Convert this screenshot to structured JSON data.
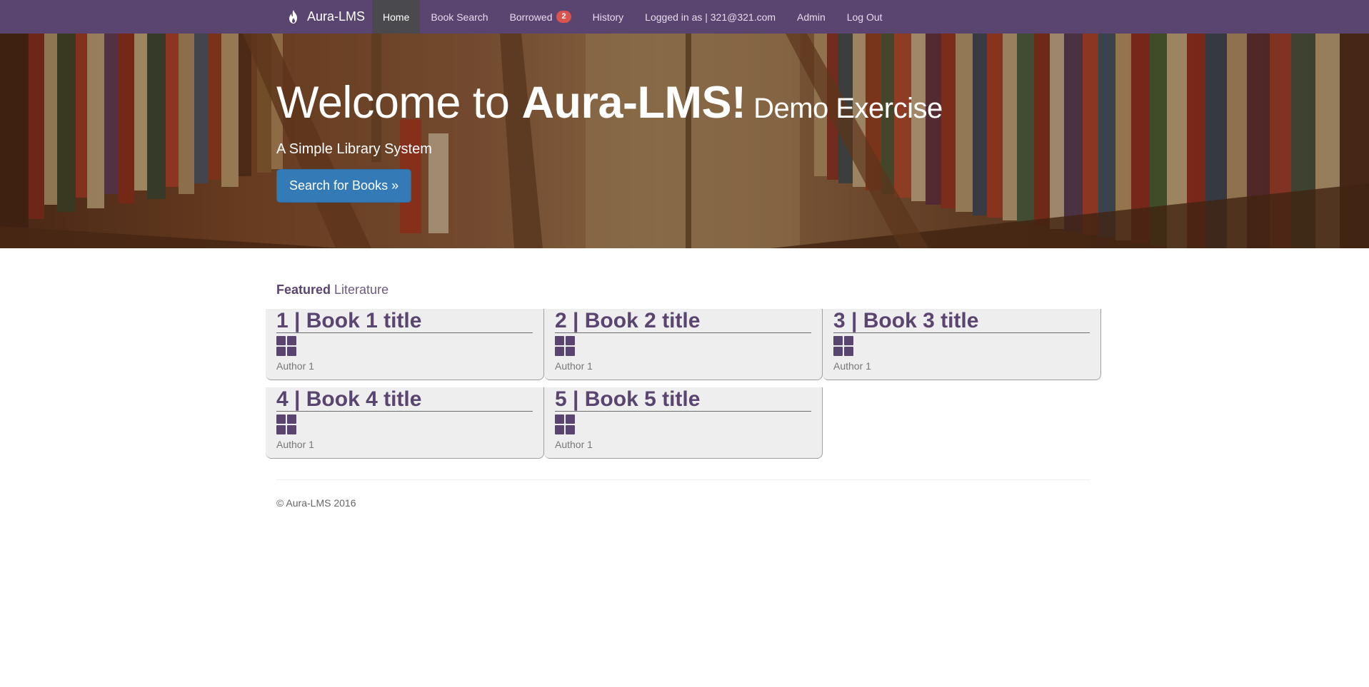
{
  "navbar": {
    "brand": "Aura-LMS",
    "items": [
      {
        "label": "Home",
        "active": true
      },
      {
        "label": "Book Search"
      },
      {
        "label": "Borrowed",
        "badge": "2"
      },
      {
        "label": "History"
      },
      {
        "label": "Logged in as | 321@321.com"
      },
      {
        "label": "Admin"
      },
      {
        "label": "Log Out"
      }
    ]
  },
  "hero": {
    "title_light": "Welcome to ",
    "title_bold": "Aura-LMS!",
    "title_small": " Demo Exercise",
    "subtitle": "A Simple Library System",
    "button_label": "Search for Books »"
  },
  "featured": {
    "heading_bold": "Featured",
    "heading_light": " Literature",
    "books": [
      {
        "title": "1 | Book 1 title",
        "author": "Author 1"
      },
      {
        "title": "2 | Book 2 title",
        "author": "Author 1"
      },
      {
        "title": "3 | Book 3 title",
        "author": "Author 1"
      },
      {
        "title": "4 | Book 4 title",
        "author": "Author 1"
      },
      {
        "title": "5 | Book 5 title",
        "author": "Author 1"
      }
    ]
  },
  "footer": {
    "text": "© Aura-LMS 2016"
  },
  "colors": {
    "navbar": "#5a4470",
    "accent": "#5a4470",
    "button": "#337ab7",
    "badge": "#d9534f"
  }
}
